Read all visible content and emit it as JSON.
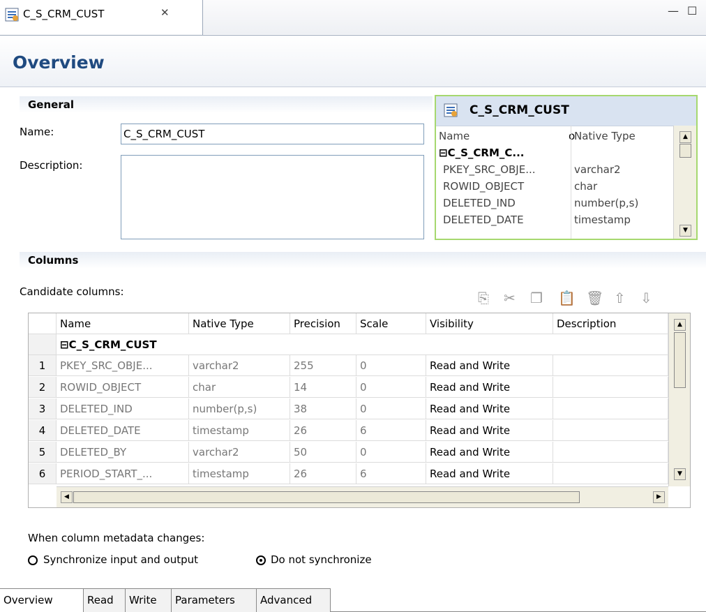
{
  "editor_tab": {
    "title": "C_S_CRM_CUST",
    "close_glyph": "✕",
    "icon": "data-object-icon"
  },
  "window_controls": {
    "minimize_glyph": "—",
    "maximize_glyph": "☐"
  },
  "form": {
    "title": "Overview"
  },
  "general": {
    "heading": "General",
    "name_label": "Name:",
    "name_value": "C_S_CRM_CUST",
    "description_label": "Description:",
    "description_value": ""
  },
  "mini_panel": {
    "title": "C_S_CRM_CUST",
    "col_name": "Name",
    "col_native_type": "Native Type",
    "group": "⊟C_S_CRM_C...",
    "rows": [
      {
        "name": "PKEY_SRC_OBJE...",
        "type": "varchar2"
      },
      {
        "name": "ROWID_OBJECT",
        "type": "char"
      },
      {
        "name": "DELETED_IND",
        "type": "number(p,s)"
      },
      {
        "name": "DELETED_DATE",
        "type": "timestamp"
      }
    ]
  },
  "columns": {
    "heading": "Columns",
    "candidate_label": "Candidate columns:",
    "toolbar_icons": [
      "new-icon",
      "cut-icon",
      "copy-icon",
      "paste-icon",
      "delete-icon",
      "move-up-icon",
      "move-down-icon"
    ],
    "headers": [
      "Name",
      "Native Type",
      "Precision",
      "Scale",
      "Visibility",
      "Description"
    ],
    "group_row": "⊟C_S_CRM_CUST",
    "rows": [
      {
        "num": "1",
        "name": "PKEY_SRC_OBJE...",
        "type": "varchar2",
        "precision": "255",
        "scale": "0",
        "visibility": "Read and Write",
        "description": ""
      },
      {
        "num": "2",
        "name": "ROWID_OBJECT",
        "type": "char",
        "precision": "14",
        "scale": "0",
        "visibility": "Read and Write",
        "description": ""
      },
      {
        "num": "3",
        "name": "DELETED_IND",
        "type": "number(p,s)",
        "precision": "38",
        "scale": "0",
        "visibility": "Read and Write",
        "description": ""
      },
      {
        "num": "4",
        "name": "DELETED_DATE",
        "type": "timestamp",
        "precision": "26",
        "scale": "6",
        "visibility": "Read and Write",
        "description": ""
      },
      {
        "num": "5",
        "name": "DELETED_BY",
        "type": "varchar2",
        "precision": "50",
        "scale": "0",
        "visibility": "Read and Write",
        "description": ""
      },
      {
        "num": "6",
        "name": "PERIOD_START_...",
        "type": "timestamp",
        "precision": "26",
        "scale": "6",
        "visibility": "Read and Write",
        "description": ""
      }
    ]
  },
  "sync": {
    "label": "When column metadata changes:",
    "option_sync": "Synchronize input and output",
    "option_nosync": "Do not synchronize",
    "selected": "Do not synchronize"
  },
  "bottom_tabs": [
    "Overview",
    "Read",
    "Write",
    "Parameters",
    "Advanced"
  ],
  "active_bottom_tab": "Overview"
}
